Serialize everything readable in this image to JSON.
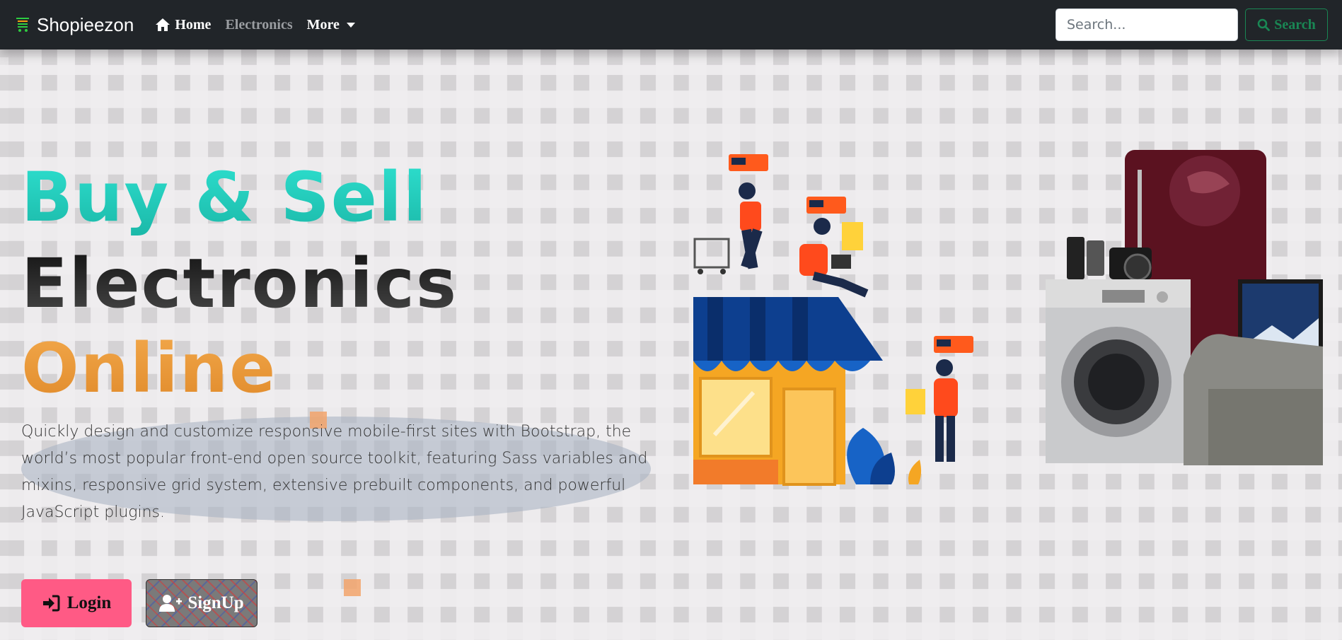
{
  "navbar": {
    "brand": "Shopieezon",
    "links": [
      {
        "label": "Home",
        "icon": "home-icon"
      },
      {
        "label": "Electronics"
      },
      {
        "label": "More",
        "icon": "caret-down-icon"
      }
    ],
    "search_placeholder": "Search...",
    "search_button": "Search"
  },
  "hero": {
    "line1": "Buy & Sell",
    "line2": "Electronics",
    "line3": "Online",
    "lead": "Quickly design and customize responsive mobile-first sites with Bootstrap, the world’s most popular front-end open source toolkit, featuring Sass variables and mixins, responsive grid system, extensive prebuilt components, and powerful JavaScript plugins.",
    "login_label": "Login",
    "signup_label": "SignUp"
  },
  "colors": {
    "navbar_bg": "#212529",
    "accent_teal": "#1fcfbd",
    "accent_orange": "#ea9a3a",
    "login_bg": "#ff5a85",
    "search_green": "#198754"
  }
}
